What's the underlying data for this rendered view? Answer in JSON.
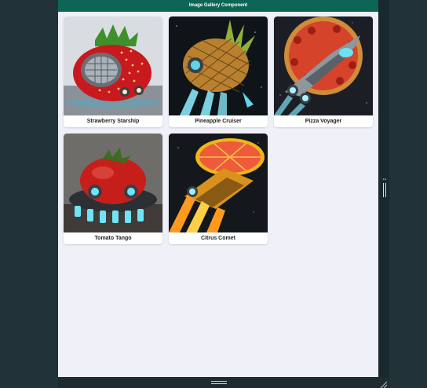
{
  "header": {
    "title": "Image Gallery Component"
  },
  "gallery": {
    "items": [
      {
        "title": "Strawberry Starship",
        "image_icon": "strawberry-starship-image"
      },
      {
        "title": "Pineapple Cruiser",
        "image_icon": "pineapple-cruiser-image"
      },
      {
        "title": "Pizza Voyager",
        "image_icon": "pizza-voyager-image"
      },
      {
        "title": "Tomato Tango",
        "image_icon": "tomato-tango-image"
      },
      {
        "title": "Citrus Comet",
        "image_icon": "citrus-comet-image"
      }
    ]
  },
  "colors": {
    "header_bg": "#0b6656",
    "page_bg": "#f0f0f8",
    "outer_bg": "#213238"
  }
}
